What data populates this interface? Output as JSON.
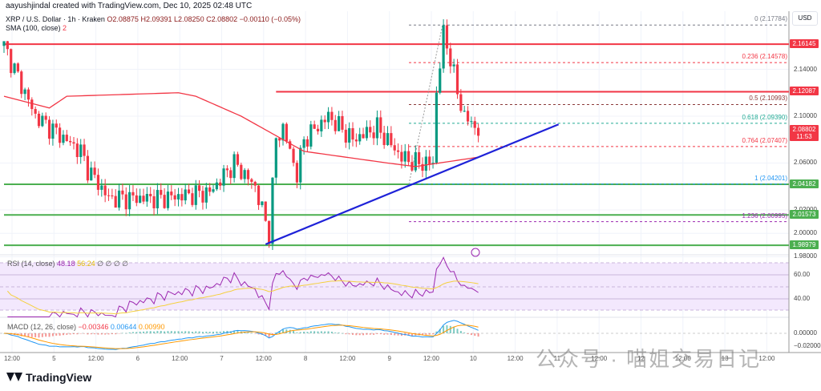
{
  "header": {
    "credit": "aayushjindal created with TradingView.com, Dec 10, 2025 02:48 UTC",
    "symbol": "XRP / U.S. Dollar · 1h · Kraken",
    "open": "O2.08875",
    "high": "H2.09391",
    "low": "L2.08250",
    "close": "C2.08802",
    "change": "−0.00110 (−0.05%)",
    "sma_label": "SMA (100, close)",
    "sma_num": "2"
  },
  "currency": "USD",
  "price_ticks": [
    "2.14000",
    "2.10000",
    "2.06000",
    "2.02000",
    "2.00000",
    "1.98000"
  ],
  "price_tick_values": [
    2.14,
    2.1,
    2.06,
    2.02,
    2.0,
    1.98
  ],
  "levels": [
    {
      "label": "2.16145",
      "value": 2.16145,
      "color": "#f23645",
      "start": 0
    },
    {
      "label": "2.12087",
      "value": 2.12087,
      "color": "#f23645",
      "start": 78
    },
    {
      "label": "2.04182",
      "value": 2.04182,
      "color": "#4caf50",
      "start": 0
    },
    {
      "label": "2.01573",
      "value": 2.01573,
      "color": "#4caf50",
      "start": 0
    },
    {
      "label": "1.98979",
      "value": 1.98979,
      "color": "#4caf50",
      "start": 0
    }
  ],
  "last_price": {
    "label": "2.08802",
    "countdown": "11:53",
    "value": 2.08802
  },
  "fib": [
    {
      "label": "0 (2.17784)",
      "value": 2.17784,
      "color": "#787b86"
    },
    {
      "label": "0.236 (2.14578)",
      "value": 2.14578,
      "color": "#f23645"
    },
    {
      "label": "0.5 (2.10993)",
      "value": 2.10993,
      "color": "#8b3a3a"
    },
    {
      "label": "0.618 (2.09390)",
      "value": 2.0939,
      "color": "#22ab94"
    },
    {
      "label": "0.764 (2.07407)",
      "value": 2.07407,
      "color": "#f23645"
    },
    {
      "label": "1 (2.04201)",
      "value": 2.04201,
      "color": "#2196f3"
    },
    {
      "label": "1.236 (2.00995)",
      "value": 2.00995,
      "color": "#9c27b0"
    }
  ],
  "price_anchors": [
    [
      0,
      2.16
    ],
    [
      3,
      2.14
    ],
    [
      9,
      2.1
    ],
    [
      22,
      2.07
    ],
    [
      24,
      2.055
    ],
    [
      30,
      2.03
    ],
    [
      45,
      2.03
    ],
    [
      59,
      2.035
    ],
    [
      66,
      2.06
    ],
    [
      72,
      2.04
    ],
    [
      76,
      2.0
    ],
    [
      78,
      2.08
    ],
    [
      80,
      2.09
    ],
    [
      84,
      2.05
    ],
    [
      86,
      2.08
    ],
    [
      93,
      2.1
    ],
    [
      100,
      2.08
    ],
    [
      107,
      2.09
    ],
    [
      114,
      2.065
    ],
    [
      118,
      2.06
    ],
    [
      123,
      2.06
    ],
    [
      124,
      2.12
    ],
    [
      126,
      2.17
    ],
    [
      128,
      2.15
    ],
    [
      130,
      2.12
    ],
    [
      132,
      2.1
    ],
    [
      136,
      2.088
    ]
  ],
  "sma_anchors": [
    [
      0,
      2.117
    ],
    [
      13,
      2.107
    ],
    [
      18,
      2.117
    ],
    [
      50,
      2.12
    ],
    [
      55,
      2.117
    ],
    [
      68,
      2.1
    ],
    [
      86,
      2.07
    ],
    [
      110,
      2.06
    ],
    [
      118,
      2.057
    ],
    [
      136,
      2.065
    ]
  ],
  "trend": {
    "from_index": 75,
    "from_price": 1.9906,
    "to_index": 159,
    "to_price": 2.093
  },
  "rsi": {
    "legend": "RSI (14, close)",
    "value": "48.18",
    "ma": "56.24",
    "extra": "∅ ∅ ∅ ∅",
    "ticks": [
      "60.00",
      "40.00"
    ]
  },
  "macd": {
    "legend": "MACD (12, 26, close)",
    "macd": "−0.00346",
    "signal": "0.00644",
    "hist": "0.00990",
    "ticks": [
      "0.00000",
      "−0.02000"
    ]
  },
  "time_axis": [
    "12:00",
    "5",
    "12:00",
    "6",
    "12:00",
    "7",
    "12:00",
    "8",
    "12:00",
    "9",
    "12:00",
    "10",
    "12:00",
    "11",
    "12:00",
    "12",
    "12:00",
    "13",
    "12:00"
  ],
  "brand": "TradingView",
  "watermark": "公众号 · 喵姐交易日记",
  "colors": {
    "up": "#089981",
    "down": "#f23645",
    "sma": "#f23645",
    "trend": "#1e22d8"
  }
}
